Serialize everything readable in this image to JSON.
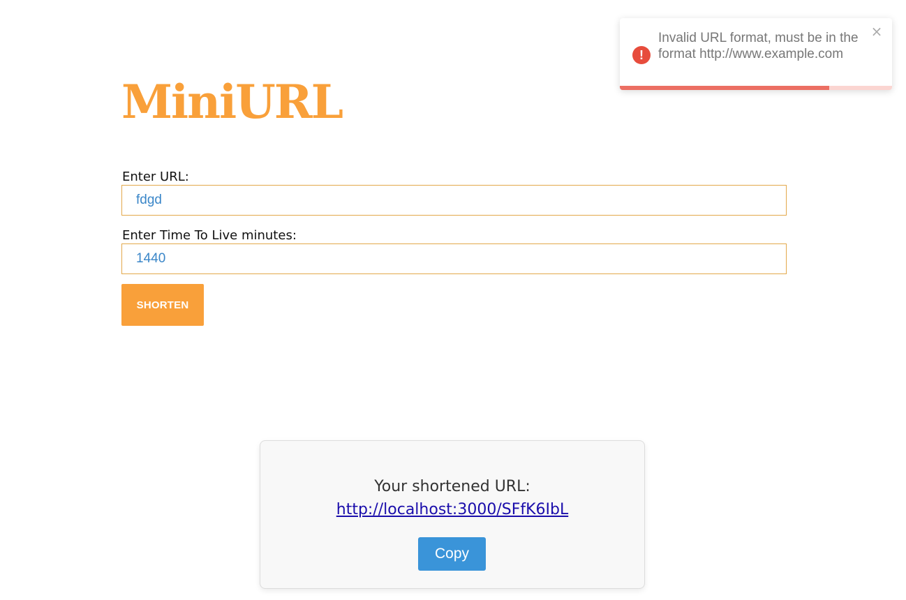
{
  "app": {
    "logo": "MiniURL"
  },
  "form": {
    "url_label": "Enter URL:",
    "url_value": "fdgd",
    "ttl_label": "Enter Time To Live minutes:",
    "ttl_value": "1440",
    "shorten_label": "SHORTEN"
  },
  "result": {
    "title": "Your shortened URL:",
    "link": "http://localhost:3000/SFfK6IbL",
    "copy_label": "Copy"
  },
  "toast": {
    "type": "error",
    "icon": "exclamation-circle-icon",
    "icon_glyph": "!",
    "message": "Invalid URL format, must be in the format http://www.example.com",
    "close_glyph": "×",
    "progress": 0.77
  },
  "colors": {
    "brand_orange": "#f9a03a",
    "input_border": "#e3a84a",
    "input_text": "#3a86c8",
    "copy_blue": "#3a94d9",
    "link_blue": "#1a0dab",
    "error_red": "#e74c3c",
    "progress_fill": "#ec6f63",
    "progress_track": "#fbd5d1"
  }
}
